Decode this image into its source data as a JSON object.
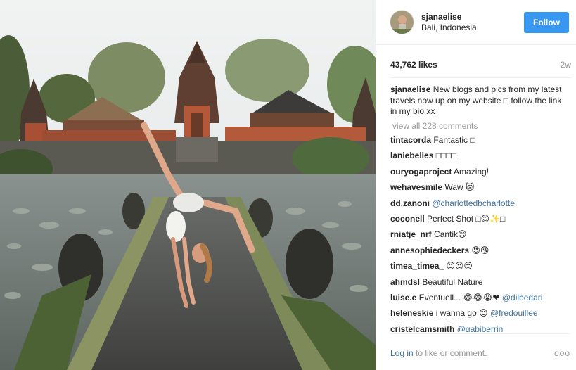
{
  "post": {
    "username": "sjanaelise",
    "location": "Bali, Indonesia",
    "follow_label": "Follow",
    "likes": "43,762 likes",
    "age": "2w",
    "caption_user": "sjanaelise",
    "caption_text": " New blogs and pics from my latest travels now up on my website □ follow the link in my bio xx",
    "view_all": "view all 228 comments"
  },
  "comments": [
    {
      "user": "tintacorda",
      "text": " Fantastic □",
      "mention": ""
    },
    {
      "user": "laniebelles",
      "text": " □□□□",
      "mention": ""
    },
    {
      "user": "ouryogaproject",
      "text": " Amazing!",
      "mention": ""
    },
    {
      "user": "wehavesmile",
      "text": " Waw 😻",
      "mention": ""
    },
    {
      "user": "dd.zanoni",
      "text": " ",
      "mention": "@charlottedbcharlotte"
    },
    {
      "user": "coconell",
      "text": " Perfect Shot □😊✨□",
      "mention": ""
    },
    {
      "user": "rniatje_nrf",
      "text": " Cantik😊",
      "mention": ""
    },
    {
      "user": "annesophiedeckers",
      "text": " 😍😘",
      "mention": ""
    },
    {
      "user": "timea_timea_",
      "text": " 😍😍😍",
      "mention": ""
    },
    {
      "user": "ahmdsl",
      "text": " Beautiful Nature",
      "mention": ""
    },
    {
      "user": "luise.e",
      "text": " Eventuell... 😂😂😭❤ ",
      "mention": "@dilbedari"
    },
    {
      "user": "heleneskie",
      "text": " i wanna go 😊 ",
      "mention": "@fredouillee"
    },
    {
      "user": "cristelcamsmith",
      "text": " ",
      "mention": "@gabiberrin"
    }
  ],
  "footer": {
    "login_link": "Log in",
    "login_rest": " to like or comment.",
    "more": "ooo"
  },
  "icons": {
    "more": "more-options-icon",
    "avatar": "profile-avatar"
  },
  "colors": {
    "follow_button": "#3897f0",
    "mention": "#3f729b",
    "muted": "#999999"
  }
}
